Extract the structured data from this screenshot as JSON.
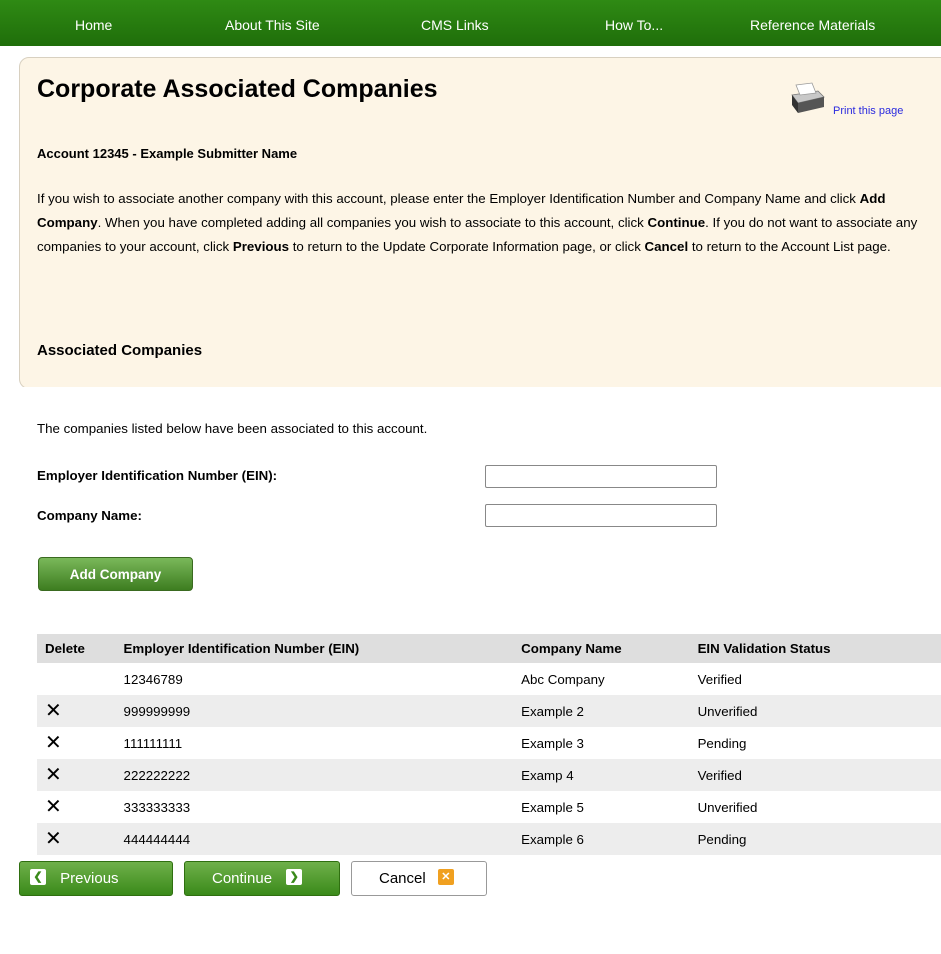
{
  "nav": {
    "home": "Home",
    "about": "About This Site",
    "cms_links": "CMS Links",
    "how_to": "How To...",
    "reference": "Reference Materials"
  },
  "page": {
    "title": "Corporate Associated Companies",
    "print_link": "Print this page",
    "account_line": "Account 12345 - Example Submitter Name",
    "intro": {
      "t1": "If you wish to associate another company with this account, please enter the Employer Identification Number and Company Name and click ",
      "b1": "Add Company",
      "t2": ". When you have completed adding all companies you wish to associate to this account, click ",
      "b2": "Continue",
      "t3": ". If you do not want to associate any companies to your account, click ",
      "b3": "Previous",
      "t4": " to return to the Update Corporate Information page, or click ",
      "b4": "Cancel",
      "t5": " to return to the Account List page."
    },
    "section_title": "Associated Companies",
    "listed_note": "The companies listed below have been associated to this account."
  },
  "form": {
    "ein_label": "Employer Identification Number (EIN):",
    "ein_value": "",
    "name_label": "Company Name:",
    "name_value": "",
    "add_button": "Add Company"
  },
  "table": {
    "headers": {
      "delete": "Delete",
      "ein": "Employer Identification Number (EIN)",
      "name": "Company Name",
      "status": "EIN Validation Status"
    },
    "rows": [
      {
        "ein": "12346789",
        "name": "Abc Company",
        "status": "Verified",
        "deletable": false
      },
      {
        "ein": "999999999",
        "name": "Example 2",
        "status": "Unverified",
        "deletable": true
      },
      {
        "ein": "111111111",
        "name": "Example 3",
        "status": "Pending",
        "deletable": true
      },
      {
        "ein": "222222222",
        "name": "Examp 4",
        "status": "Verified",
        "deletable": true
      },
      {
        "ein": "333333333",
        "name": "Example 5",
        "status": "Unverified",
        "deletable": true
      },
      {
        "ein": "444444444",
        "name": "Example 6",
        "status": "Pending",
        "deletable": true
      }
    ],
    "delete_icon": "close-x-icon"
  },
  "buttons": {
    "previous": "Previous",
    "continue": "Continue",
    "cancel": "Cancel"
  },
  "colors": {
    "nav_green": "#2a8210",
    "panel_bg": "#fdf5e6",
    "cancel_icon": "#f0a020"
  }
}
